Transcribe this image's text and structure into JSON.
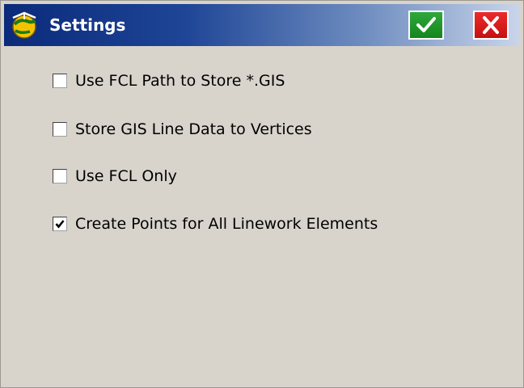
{
  "window": {
    "title": "Settings"
  },
  "icons": {
    "app": "compass-globe-icon",
    "ok": "checkmark-icon",
    "close": "close-x-icon"
  },
  "colors": {
    "titlebar_start": "#0b2a7a",
    "titlebar_end": "#c9d5ea",
    "ok_button": "#1f9a2c",
    "close_button": "#dd1d1d",
    "background": "#d8d4cc"
  },
  "options": [
    {
      "label": "Use FCL Path to Store *.GIS",
      "checked": false
    },
    {
      "label": "Store GIS Line Data to Vertices",
      "checked": false
    },
    {
      "label": "Use FCL Only",
      "checked": false
    },
    {
      "label": "Create Points for All Linework Elements",
      "checked": true
    }
  ]
}
